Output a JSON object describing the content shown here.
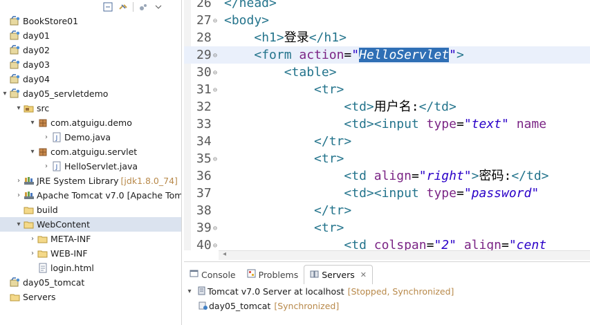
{
  "explorer": {
    "toolbar": [
      "collapse-all-icon",
      "link-with-editor-icon",
      "view-menu-icon",
      "dropdown-icon"
    ],
    "items": [
      {
        "label": "BookStore01",
        "indent": 0,
        "twisty": "",
        "icon": "project-icon"
      },
      {
        "label": "day01",
        "indent": 0,
        "twisty": "",
        "icon": "project-icon"
      },
      {
        "label": "day02",
        "indent": 0,
        "twisty": "",
        "icon": "project-icon"
      },
      {
        "label": "day03",
        "indent": 0,
        "twisty": "",
        "icon": "project-icon"
      },
      {
        "label": "day04",
        "indent": 0,
        "twisty": "",
        "icon": "project-icon"
      },
      {
        "label": "day05_servletdemo",
        "indent": 0,
        "twisty": "▾",
        "icon": "project-icon"
      },
      {
        "label": "src",
        "indent": 1,
        "twisty": "▾",
        "icon": "source-folder-icon"
      },
      {
        "label": "com.atguigu.demo",
        "indent": 2,
        "twisty": "▾",
        "icon": "package-icon"
      },
      {
        "label": "Demo.java",
        "indent": 3,
        "twisty": "›",
        "icon": "java-file-icon"
      },
      {
        "label": "com.atguigu.servlet",
        "indent": 2,
        "twisty": "▾",
        "icon": "package-icon"
      },
      {
        "label": "HelloServlet.java",
        "indent": 3,
        "twisty": "›",
        "icon": "java-file-icon"
      },
      {
        "label": "JRE System Library",
        "decor": "[jdk1.8.0_74]",
        "indent": 1,
        "twisty": "›",
        "icon": "library-icon"
      },
      {
        "label": "Apache Tomcat v7.0 [Apache Tom",
        "indent": 1,
        "twisty": "›",
        "icon": "library-icon"
      },
      {
        "label": "build",
        "indent": 1,
        "twisty": "",
        "icon": "folder-icon"
      },
      {
        "label": "WebContent",
        "indent": 1,
        "twisty": "▾",
        "icon": "folder-icon",
        "selected": true
      },
      {
        "label": "META-INF",
        "indent": 2,
        "twisty": "›",
        "icon": "folder-icon"
      },
      {
        "label": "WEB-INF",
        "indent": 2,
        "twisty": "›",
        "icon": "folder-icon"
      },
      {
        "label": "login.html",
        "indent": 2,
        "twisty": "",
        "icon": "html-file-icon"
      },
      {
        "label": "day05_tomcat",
        "indent": 0,
        "twisty": "",
        "icon": "project-icon"
      },
      {
        "label": "Servers",
        "indent": 0,
        "twisty": "",
        "icon": "folder-icon"
      }
    ]
  },
  "editor": {
    "lines": [
      {
        "num": "26",
        "fold": "",
        "parts": [
          [
            "tag",
            "</head>"
          ]
        ]
      },
      {
        "num": "27",
        "fold": "⊖",
        "parts": [
          [
            "tag",
            "<body>"
          ]
        ]
      },
      {
        "num": "28",
        "fold": "",
        "parts": [
          [
            "plain",
            "    "
          ],
          [
            "tag",
            "<h1>"
          ],
          [
            "plain",
            "登录"
          ],
          [
            "tag",
            "</h1>"
          ]
        ]
      },
      {
        "num": "29",
        "fold": "⊖",
        "current": true,
        "parts": [
          [
            "plain",
            "    "
          ],
          [
            "tag",
            "<form "
          ],
          [
            "attr",
            "action"
          ],
          [
            "plain",
            "="
          ],
          [
            "val",
            "\""
          ],
          [
            "sel",
            "HelloServlet"
          ],
          [
            "val",
            "\""
          ],
          [
            "tag",
            ">"
          ]
        ]
      },
      {
        "num": "30",
        "fold": "⊖",
        "parts": [
          [
            "plain",
            "        "
          ],
          [
            "tag",
            "<table>"
          ]
        ]
      },
      {
        "num": "31",
        "fold": "⊖",
        "parts": [
          [
            "plain",
            "            "
          ],
          [
            "tag",
            "<tr>"
          ]
        ]
      },
      {
        "num": "32",
        "fold": "",
        "parts": [
          [
            "plain",
            "                "
          ],
          [
            "tag",
            "<td>"
          ],
          [
            "plain",
            "用户名:"
          ],
          [
            "tag",
            "</td>"
          ]
        ]
      },
      {
        "num": "33",
        "fold": "",
        "parts": [
          [
            "plain",
            "                "
          ],
          [
            "tag",
            "<td><input "
          ],
          [
            "attr",
            "type"
          ],
          [
            "plain",
            "="
          ],
          [
            "val",
            "\"text\""
          ],
          [
            "plain",
            " "
          ],
          [
            "attr",
            "name"
          ]
        ]
      },
      {
        "num": "34",
        "fold": "",
        "parts": [
          [
            "plain",
            "            "
          ],
          [
            "tag",
            "</tr>"
          ]
        ]
      },
      {
        "num": "35",
        "fold": "⊖",
        "parts": [
          [
            "plain",
            "            "
          ],
          [
            "tag",
            "<tr>"
          ]
        ]
      },
      {
        "num": "36",
        "fold": "",
        "parts": [
          [
            "plain",
            "                "
          ],
          [
            "tag",
            "<td "
          ],
          [
            "attr",
            "align"
          ],
          [
            "plain",
            "="
          ],
          [
            "val",
            "\"right\""
          ],
          [
            "tag",
            ">"
          ],
          [
            "plain",
            "密码:"
          ],
          [
            "tag",
            "</td>"
          ]
        ]
      },
      {
        "num": "37",
        "fold": "",
        "parts": [
          [
            "plain",
            "                "
          ],
          [
            "tag",
            "<td><input "
          ],
          [
            "attr",
            "type"
          ],
          [
            "plain",
            "="
          ],
          [
            "val",
            "\"password\""
          ]
        ]
      },
      {
        "num": "38",
        "fold": "",
        "parts": [
          [
            "plain",
            "            "
          ],
          [
            "tag",
            "</tr>"
          ]
        ]
      },
      {
        "num": "39",
        "fold": "⊖",
        "parts": [
          [
            "plain",
            "            "
          ],
          [
            "tag",
            "<tr>"
          ]
        ]
      },
      {
        "num": "40",
        "fold": "⊖",
        "parts": [
          [
            "plain",
            "                "
          ],
          [
            "tag",
            "<td "
          ],
          [
            "attr",
            "colspan"
          ],
          [
            "plain",
            "="
          ],
          [
            "val",
            "\"2\""
          ],
          [
            "plain",
            " "
          ],
          [
            "attr",
            "align"
          ],
          [
            "plain",
            "="
          ],
          [
            "val",
            "\"cent"
          ]
        ]
      }
    ]
  },
  "panel": {
    "tabs": [
      {
        "label": "Console",
        "icon": "console-icon",
        "active": false
      },
      {
        "label": "Problems",
        "icon": "problems-icon",
        "active": false
      },
      {
        "label": "Servers",
        "icon": "servers-icon",
        "active": true
      }
    ],
    "close_glyph": "✕",
    "server": {
      "label": "Tomcat v7.0 Server at localhost",
      "state": "[Stopped, Synchronized]",
      "twisty": "▾"
    },
    "module": {
      "label": "day05_tomcat",
      "state": "[Synchronized]"
    }
  },
  "colors": {
    "tag": "#24748c",
    "attr": "#7b2585",
    "value": "#2a00c8",
    "selection": "#2f6fb5",
    "decoration": "#b8894a"
  }
}
